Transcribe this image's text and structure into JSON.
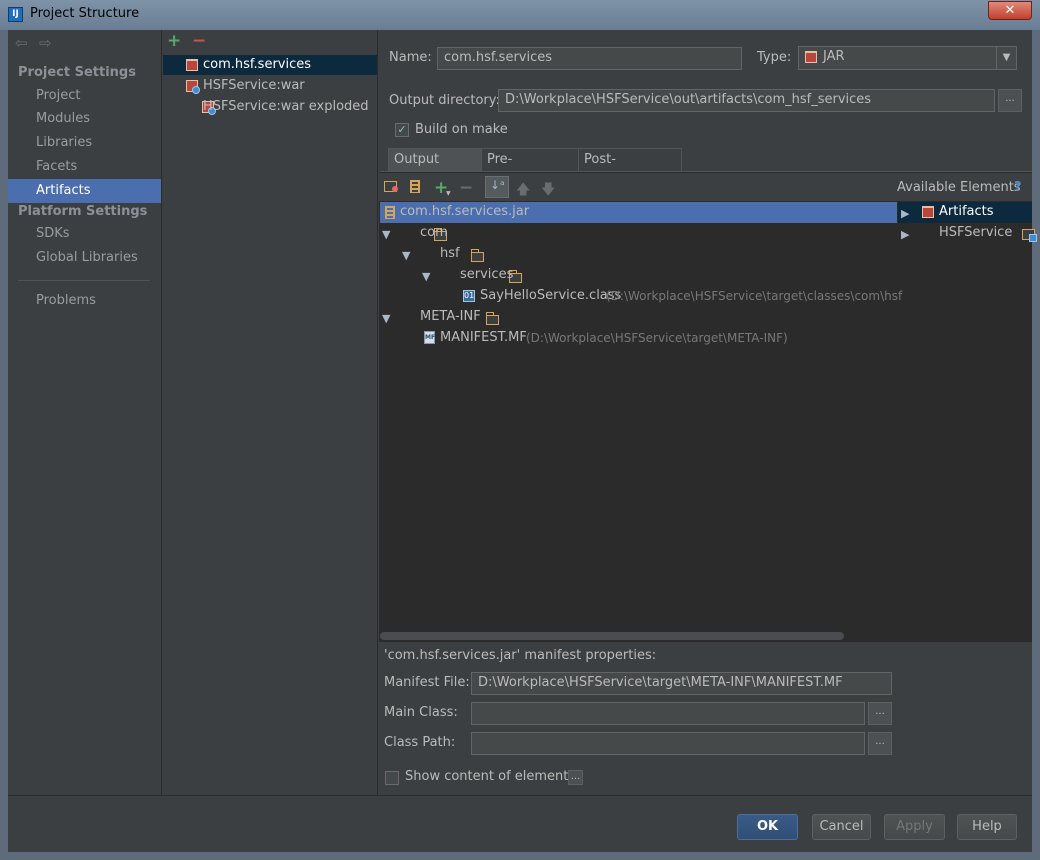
{
  "window": {
    "title": "Project Structure",
    "close_glyph": "✕",
    "app_glyph": "IJ"
  },
  "sidebar": {
    "back_glyph": "⇦",
    "forward_glyph": "⇨",
    "project_settings_title": "Project Settings",
    "project_items": [
      "Project",
      "Modules",
      "Libraries",
      "Facets",
      "Artifacts"
    ],
    "platform_settings_title": "Platform Settings",
    "platform_items": [
      "SDKs",
      "Global Libraries"
    ],
    "problems": "Problems",
    "selected": "Artifacts"
  },
  "artifacts": {
    "add_glyph": "+",
    "remove_glyph": "−",
    "items": [
      "com.hsf.services",
      "HSFService:war",
      "HSFService:war exploded"
    ],
    "selected": "com.hsf.services"
  },
  "editor": {
    "name_label": "Name:",
    "name_value": "com.hsf.services",
    "type_label": "Type:",
    "type_value": "JAR",
    "output_dir_label": "Output directory:",
    "output_dir_value": "D:\\Workplace\\HSFService\\out\\artifacts\\com_hsf_services",
    "browse_glyph": "...",
    "build_on_make_label": "Build on make",
    "build_on_make_checked": "✓",
    "tabs": [
      "Output Layout",
      "Pre-processing",
      "Post-processing"
    ],
    "active_tab": "Output Layout"
  },
  "layout": {
    "available_elements_label": "Available Elements",
    "help_glyph": "?",
    "tree": {
      "root": "com.hsf.services.jar",
      "com": "com",
      "hsf": "hsf",
      "services": "services",
      "class_file": "SayHelloService.class",
      "class_path": "(D:\\Workplace\\HSFService\\target\\classes\\com\\hsf",
      "meta_inf": "META-INF",
      "manifest": "MANIFEST.MF",
      "manifest_path": "(D:\\Workplace\\HSFService\\target\\META-INF)"
    },
    "available": [
      "Artifacts",
      "HSFService"
    ]
  },
  "manifest": {
    "title": "'com.hsf.services.jar' manifest properties:",
    "manifest_file_label": "Manifest File:",
    "manifest_file_value": "D:\\Workplace\\HSFService\\target\\META-INF\\MANIFEST.MF",
    "main_class_label": "Main Class:",
    "main_class_value": "",
    "class_path_label": "Class Path:",
    "class_path_value": "",
    "show_content_label": "Show content of elements"
  },
  "buttons": {
    "ok": "OK",
    "cancel": "Cancel",
    "apply": "Apply",
    "help": "Help"
  },
  "colors": {
    "selection": "#4b6eaf",
    "selection_inactive": "#0d293e",
    "panel": "#3c3f41",
    "tree_bg": "#2b2b2b"
  }
}
